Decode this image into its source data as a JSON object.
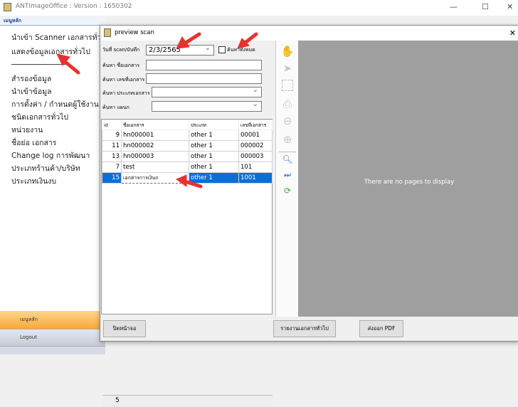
{
  "app": {
    "title": "ANTImageOffice : Version : 1650302",
    "controls": [
      "—",
      "☐",
      "✕"
    ]
  },
  "left_panel": {
    "header": "เมนูหลัก",
    "items": [
      "นำเข้า Scanner เอกสารทั่วไป",
      "แสดงข้อมูลเอกสารทั่วไป",
      "สำรองข้อมูล",
      "นำเข้าข้อมูล",
      "การตั้งค่า / กำหนดผู้ใช้งาน",
      "ชนิดเอกสารทั่วไป",
      "หน่วยงาน",
      "ชื่อย่อ เอกสาร",
      "Change log การพัฒนา",
      "ประเภทร้านค้า/บริษัท",
      "ประเภทเงินงบ"
    ],
    "main_button": "เมนูหลัก",
    "logout_button": "Logout"
  },
  "preview": {
    "title": "preview scan",
    "close": "✕",
    "filters": {
      "date_label": "วันที่ scan/บันทึก",
      "date_value": "2/3/2565",
      "search_all_label": "ค้นหาทั้งหมด",
      "search_all_checked": false,
      "doc_name_label": "ค้นหา ชื่อเอกสาร",
      "doc_name_value": "",
      "doc_no_label": "ค้นหา เลขที่เอกสาร",
      "doc_no_value": "",
      "doc_type_label": "ค้นหา ประเภทเอกสาร",
      "doc_type_value": "",
      "dept_label": "ค้นหา แผนก",
      "dept_value": ""
    },
    "grid": {
      "columns": [
        "id",
        "ชื่อเอกสาร",
        "ประเภท",
        "เลขที่เอกสาร"
      ],
      "rows": [
        [
          "9",
          "hn000001",
          "other 1",
          "00001"
        ],
        [
          "11",
          "hn000002",
          "other 1",
          "000002"
        ],
        [
          "13",
          "hn000003",
          "other 1",
          "000003"
        ],
        [
          "7",
          "test",
          "other 1",
          "101"
        ],
        [
          "15",
          "เอกสารการเงินก",
          "other 1",
          "1001"
        ]
      ],
      "selected_row": 4,
      "count": "5"
    },
    "viewer": {
      "empty_text": "There are no pages to display"
    },
    "buttons": {
      "close": "ปิดหน้าจอ",
      "report": "รายงานเอกสารทั่วไป",
      "export_pdf": "ส่งออก PDF"
    }
  },
  "colors": {
    "selection": "#0a6fd8",
    "annotation_arrow": "#e8322e",
    "main_button": "#f9a83a",
    "viewer_bg": "#9f9f9f"
  }
}
